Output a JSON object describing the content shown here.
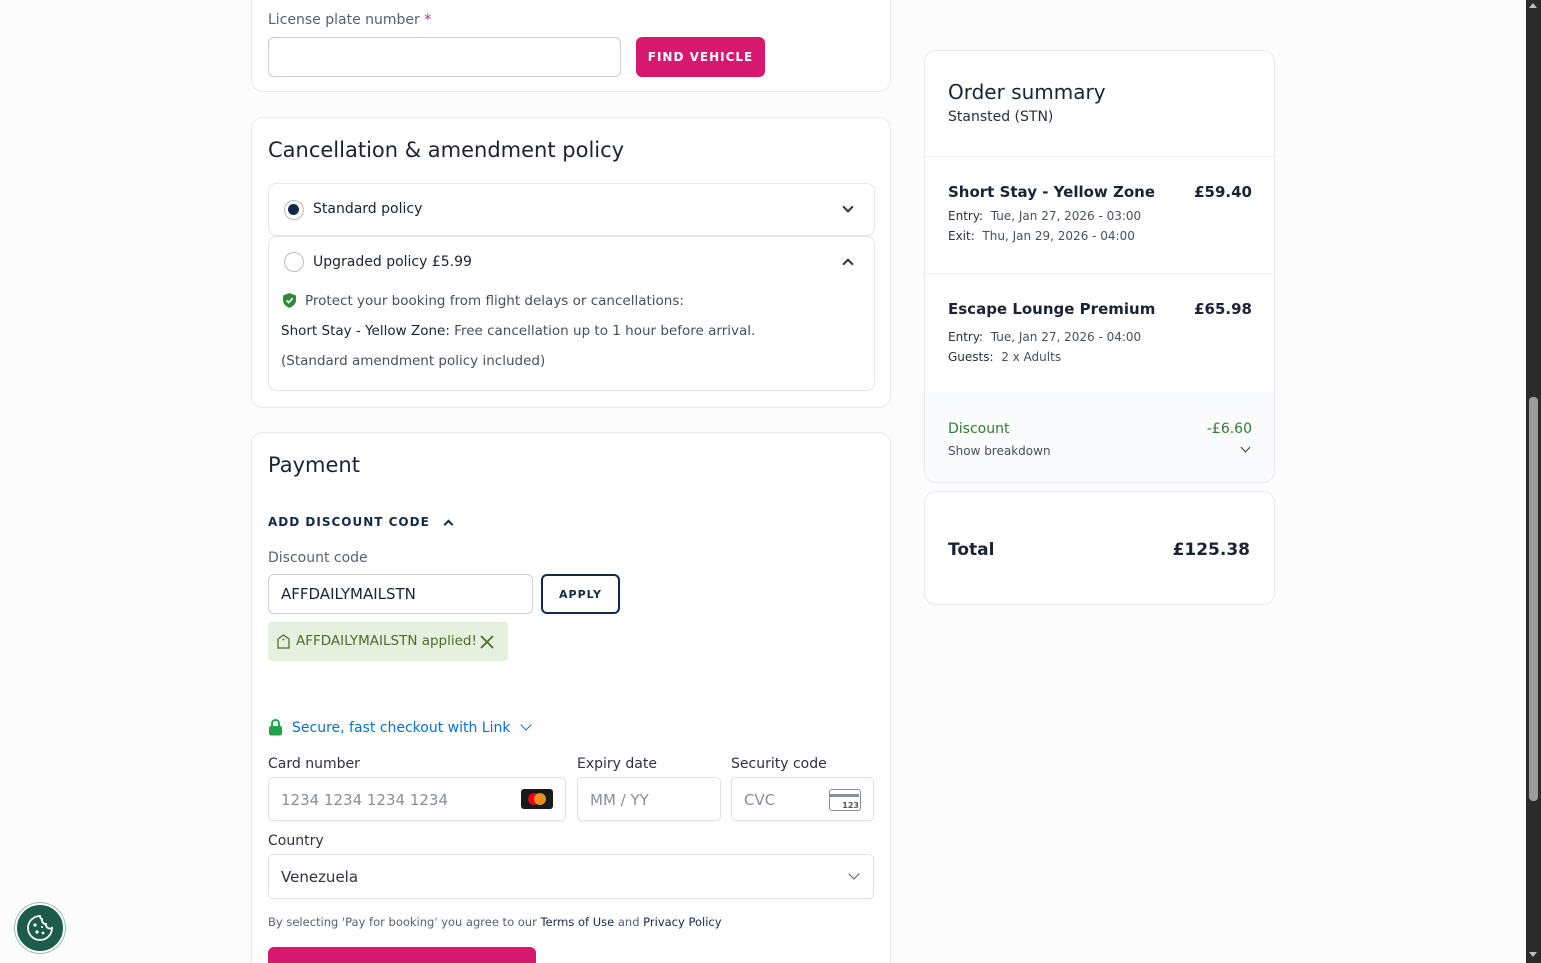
{
  "vehicle": {
    "plate_label": "License plate number",
    "required_mark": "*",
    "plate_value": "",
    "find_button": "FIND VEHICLE"
  },
  "policy": {
    "title": "Cancellation & amendment policy",
    "standard_label": "Standard policy",
    "upgraded_label": "Upgraded policy £5.99",
    "protect_text": "Protect your booking from flight delays or cancellations:",
    "zone_bold": "Short Stay - Yellow Zone:",
    "zone_text": " Free cancellation up to 1 hour before arrival.",
    "amend_text": "(Standard amendment policy included)"
  },
  "payment": {
    "title": "Payment",
    "add_discount": "ADD DISCOUNT CODE",
    "discount_label": "Discount code",
    "discount_value": "AFFDAILYMAILSTN",
    "apply_button": "APPLY",
    "applied_text": "AFFDAILYMAILSTN applied!",
    "link_text": "Secure, fast checkout with Link",
    "card_number_label": "Card number",
    "card_number_placeholder": "1234 1234 1234 1234",
    "expiry_label": "Expiry date",
    "expiry_placeholder": "MM / YY",
    "cvc_label": "Security code",
    "cvc_placeholder": "CVC",
    "cvc_icon_text": "123",
    "country_label": "Country",
    "country_value": "Venezuela",
    "terms_prefix": "By selecting 'Pay for booking' you agree to our ",
    "terms_link": "Terms of Use",
    "terms_and": " and ",
    "privacy_link": "Privacy Policy"
  },
  "summary": {
    "title": "Order summary",
    "airport": "Stansted (STN)",
    "items": [
      {
        "name": "Short Stay - Yellow Zone",
        "price": "£59.40",
        "line1_label": "Entry:",
        "line1_value": "Tue, Jan 27, 2026 - 03:00",
        "line2_label": "Exit:",
        "line2_value": "Thu, Jan 29, 2026 - 04:00"
      },
      {
        "name": "Escape Lounge Premium",
        "price": "£65.98",
        "line1_label": "Entry:",
        "line1_value": "Tue, Jan 27, 2026 - 04:00",
        "line2_label": "Guests:",
        "line2_value": "2 x Adults"
      }
    ],
    "discount_label": "Discount",
    "discount_value": "-£6.60",
    "breakdown_label": "Show breakdown",
    "total_label": "Total",
    "total_value": "£125.38"
  },
  "colors": {
    "accent_pink": "#d8176e",
    "navy": "#13294b",
    "discount_green": "#2e7d32",
    "link_blue": "#0570de"
  },
  "icons": {
    "cookie": "cookie-icon",
    "shield": "shield-check-icon",
    "lock": "lock-icon",
    "tag": "tag-icon",
    "close": "close-icon",
    "mastercard": "mastercard-icon",
    "cvc": "cvc-card-icon"
  }
}
